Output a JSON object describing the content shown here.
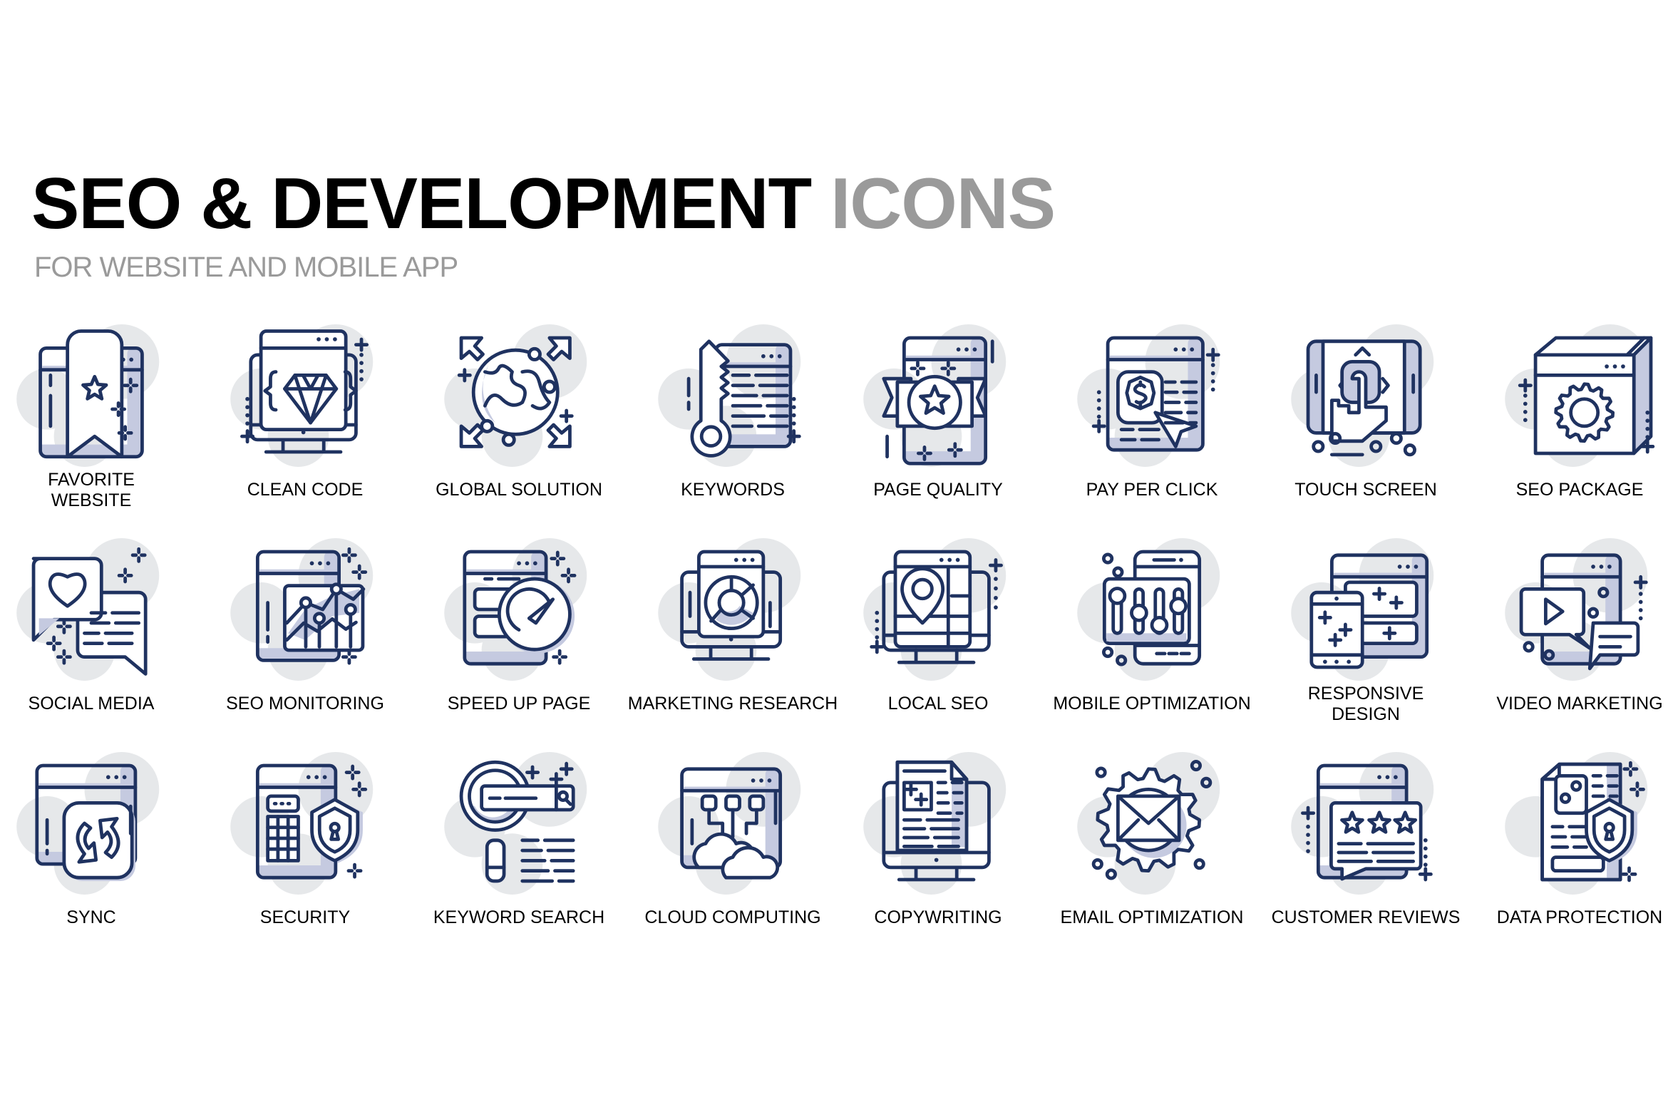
{
  "header": {
    "title_main": "SEO & DEVELOPMENT",
    "title_accent": "ICONS",
    "subtitle": "FOR WEBSITE AND MOBILE APP"
  },
  "colors": {
    "stroke": "#1f3260",
    "fill": "#c5cae0",
    "blob": "#e6e8ea",
    "title": "#000000",
    "title_accent": "#9a9a9a"
  },
  "icons": [
    {
      "label": "FAVORITE WEBSITE",
      "icon": "bookmark-star-browser-icon"
    },
    {
      "label": "CLEAN CODE",
      "icon": "diamond-code-monitor-icon"
    },
    {
      "label": "GLOBAL SOLUTION",
      "icon": "globe-arrows-icon"
    },
    {
      "label": "KEYWORDS",
      "icon": "key-document-icon"
    },
    {
      "label": "PAGE QUALITY",
      "icon": "quality-badge-page-icon"
    },
    {
      "label": "PAY PER CLICK",
      "icon": "dollar-cursor-browser-icon"
    },
    {
      "label": "TOUCH SCREEN",
      "icon": "hand-tap-tablet-icon"
    },
    {
      "label": "SEO PACKAGE",
      "icon": "gear-box-icon"
    },
    {
      "label": "SOCIAL MEDIA",
      "icon": "heart-chat-bubbles-icon"
    },
    {
      "label": "SEO MONITORING",
      "icon": "line-chart-browser-icon"
    },
    {
      "label": "SPEED UP PAGE",
      "icon": "speedometer-page-icon"
    },
    {
      "label": "MARKETING RESEARCH",
      "icon": "donut-chart-monitor-icon"
    },
    {
      "label": "LOCAL SEO",
      "icon": "map-pin-monitor-icon"
    },
    {
      "label": "MOBILE OPTIMIZATION",
      "icon": "sliders-phone-icon"
    },
    {
      "label": "RESPONSIVE DESIGN",
      "icon": "phone-browser-layout-icon"
    },
    {
      "label": "VIDEO MARKETING",
      "icon": "play-chat-browser-icon"
    },
    {
      "label": "SYNC",
      "icon": "sync-arrows-browser-icon"
    },
    {
      "label": "SECURITY",
      "icon": "keypad-shield-lock-icon"
    },
    {
      "label": "KEYWORD SEARCH",
      "icon": "magnifier-search-bar-icon"
    },
    {
      "label": "CLOUD COMPUTING",
      "icon": "cloud-network-browser-icon"
    },
    {
      "label": "COPYWRITING",
      "icon": "document-monitor-icon"
    },
    {
      "label": "EMAIL OPTIMIZATION",
      "icon": "envelope-gear-icon"
    },
    {
      "label": "CUSTOMER REVIEWS",
      "icon": "stars-review-bubble-icon"
    },
    {
      "label": "DATA PROTECTION",
      "icon": "document-shield-lock-icon"
    }
  ]
}
